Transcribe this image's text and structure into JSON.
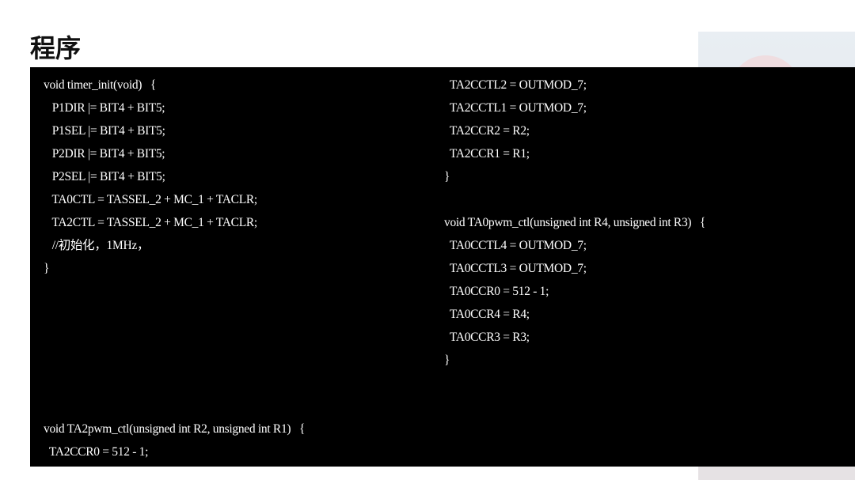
{
  "slide": {
    "title": "程序"
  },
  "code": {
    "left_block": [
      "void timer_init(void)   {",
      "   P1DIR |= BIT4 + BIT5;",
      "   P1SEL |= BIT4 + BIT5;",
      "   P2DIR |= BIT4 + BIT5;",
      "   P2SEL |= BIT4 + BIT5;",
      "   TA0CTL = TASSEL_2 + MC_1 + TACLR;",
      "   TA2CTL = TASSEL_2 + MC_1 + TACLR;",
      "   //初始化，1MHz，",
      "}"
    ],
    "right_block": [
      "  TA2CCTL2 = OUTMOD_7;",
      "  TA2CCTL1 = OUTMOD_7;",
      "  TA2CCR2 = R2;",
      "  TA2CCR1 = R1;",
      "}",
      "",
      "void TA0pwm_ctl(unsigned int R4, unsigned int R3)   {",
      "  TA0CCTL4 = OUTMOD_7;",
      "  TA0CCTL3 = OUTMOD_7;",
      "  TA0CCR0 = 512 - 1;",
      "  TA0CCR4 = R4;",
      "  TA0CCR3 = R3;",
      "}"
    ],
    "bottom_block": [
      "void TA2pwm_ctl(unsigned int R2, unsigned int R1)   {",
      "  TA2CCR0 = 512 - 1;"
    ]
  }
}
